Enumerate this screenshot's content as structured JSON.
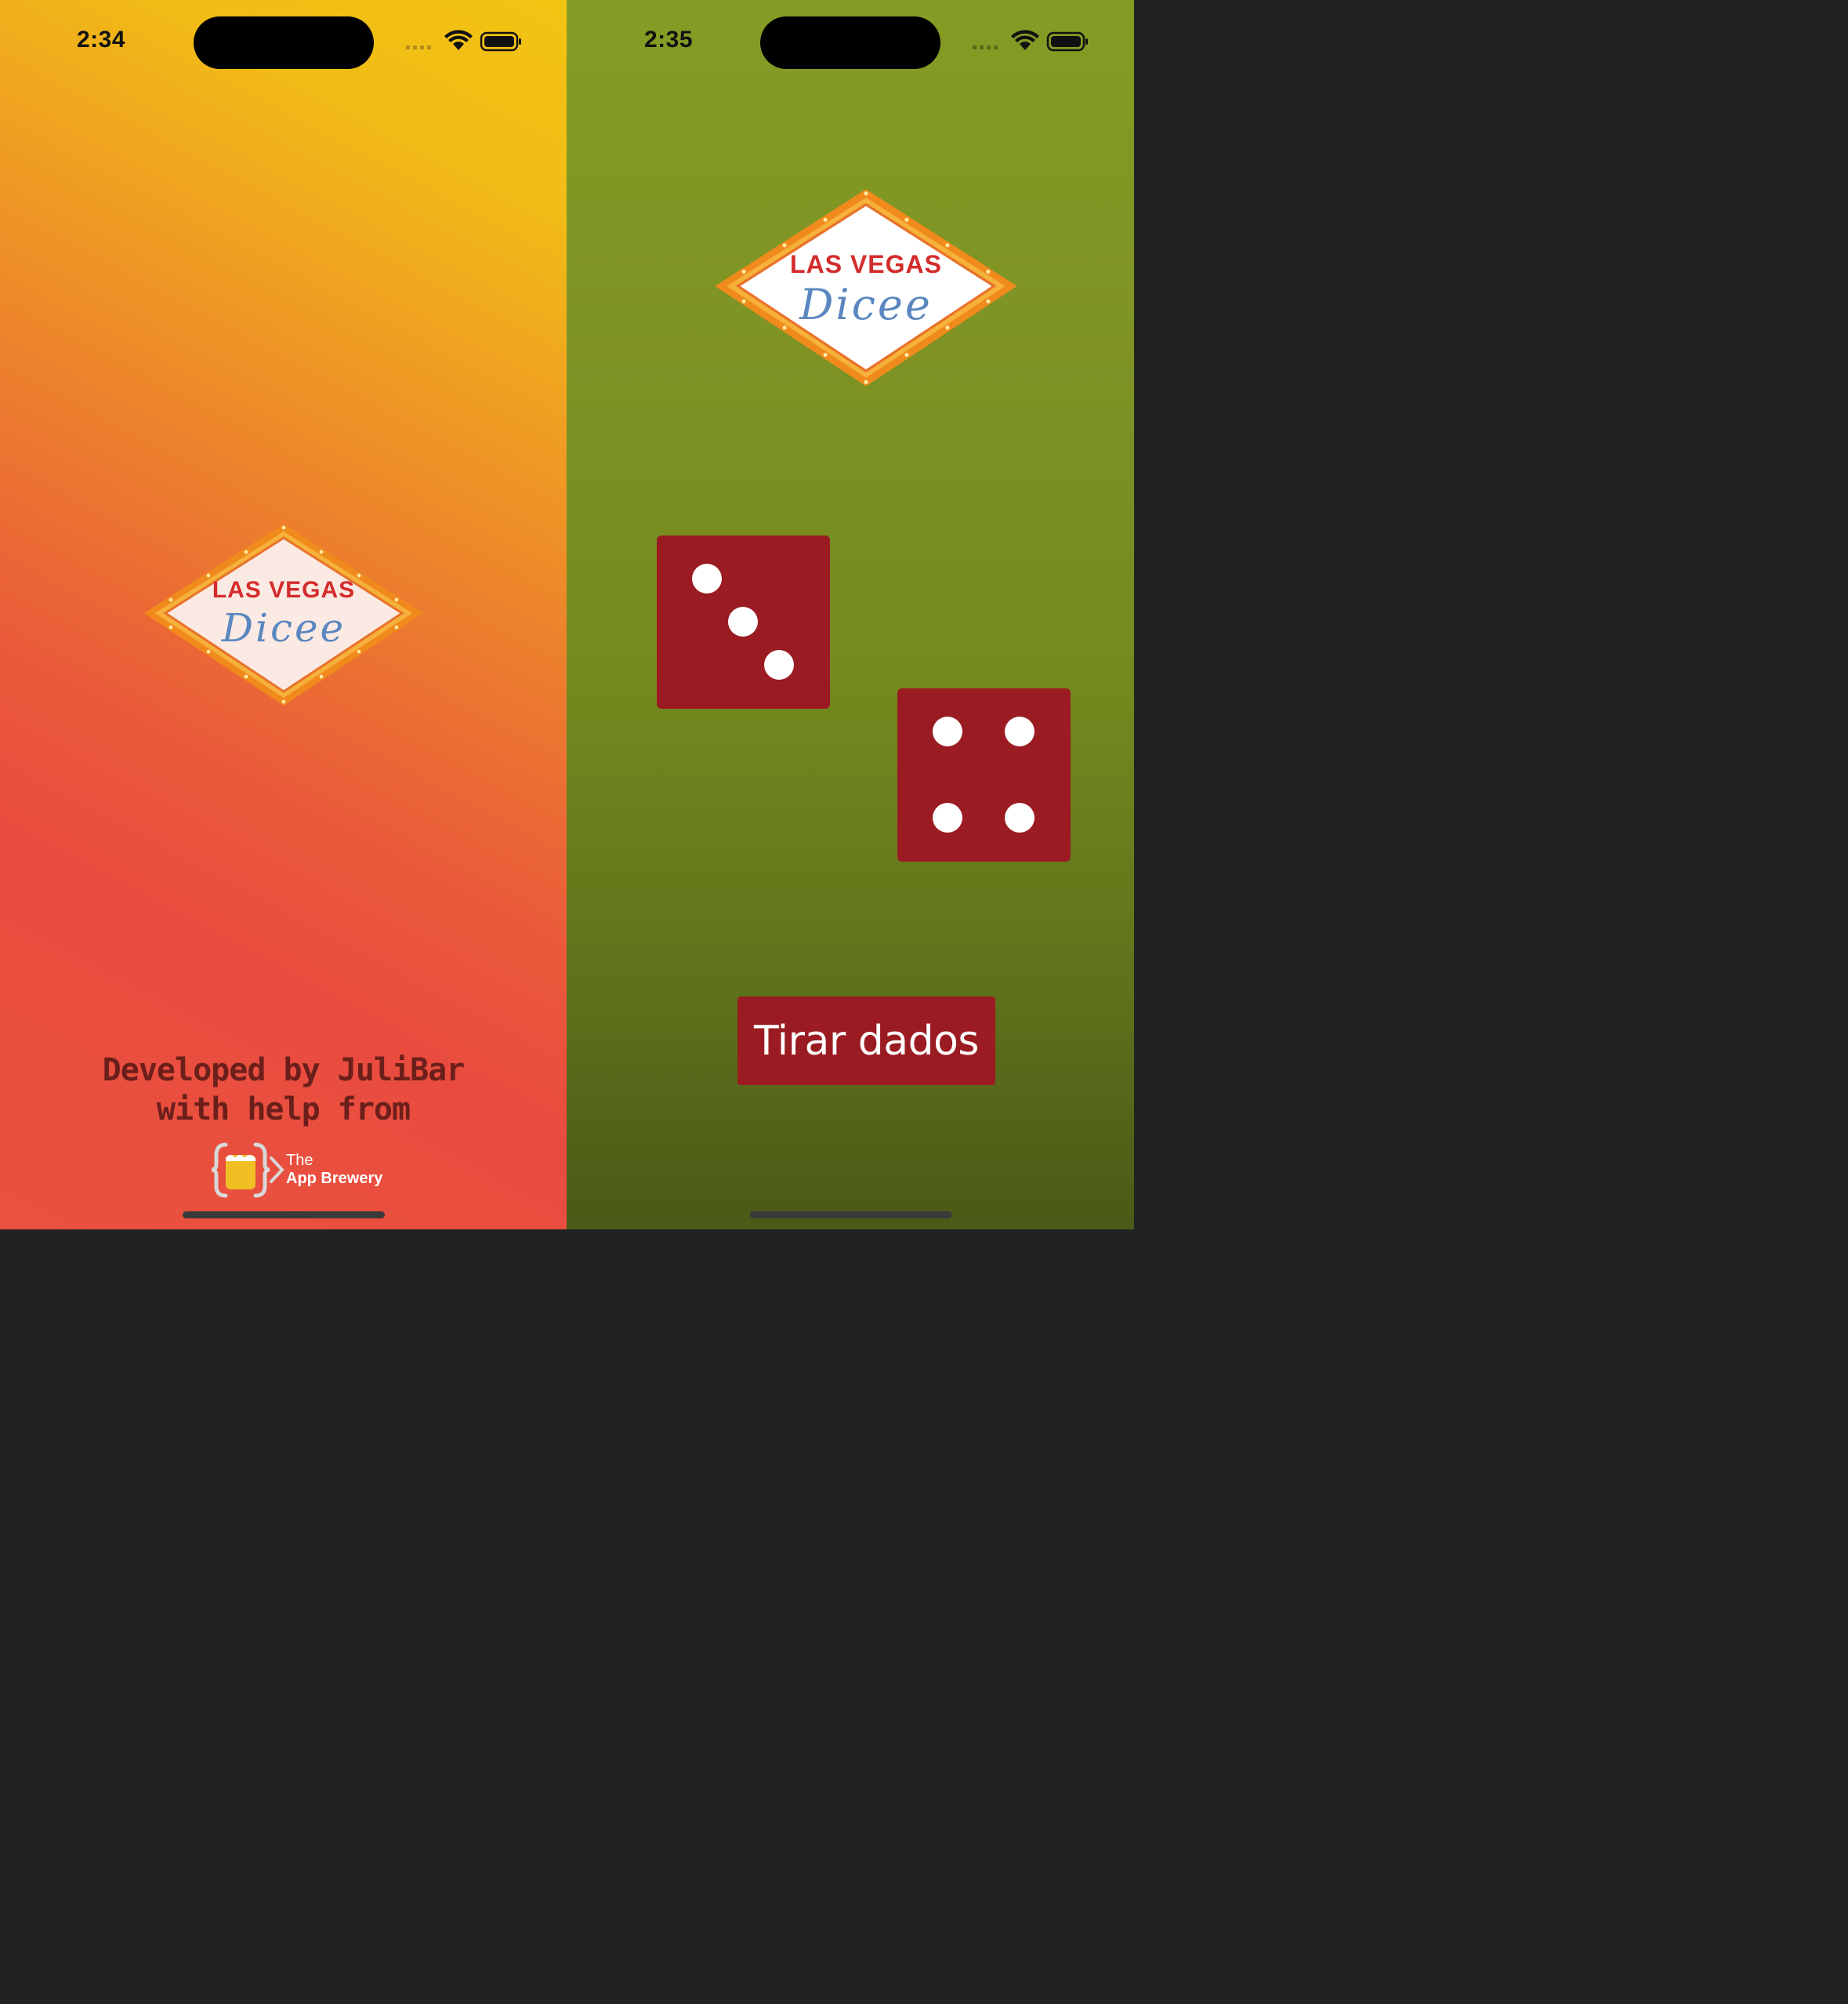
{
  "splash": {
    "status_time": "2:34",
    "logo": {
      "top_text": "LAS VEGAS",
      "script_text": "Dicee"
    },
    "credits_line1": "Developed by JuliBar",
    "credits_line2": "with help from",
    "brewery": {
      "the": "The",
      "name": "App Brewery"
    }
  },
  "game": {
    "status_time": "2:35",
    "logo": {
      "top_text": "LAS VEGAS",
      "script_text": "Dicee"
    },
    "dice": [
      {
        "value": 3
      },
      {
        "value": 4
      }
    ],
    "roll_button_label": "Tirar dados"
  },
  "colors": {
    "die": "#9b1b22",
    "felt": "#7e9324",
    "logo_red": "#d42c2c",
    "logo_blue": "#5a87bf",
    "marquee_orange": "#f08a1c"
  }
}
